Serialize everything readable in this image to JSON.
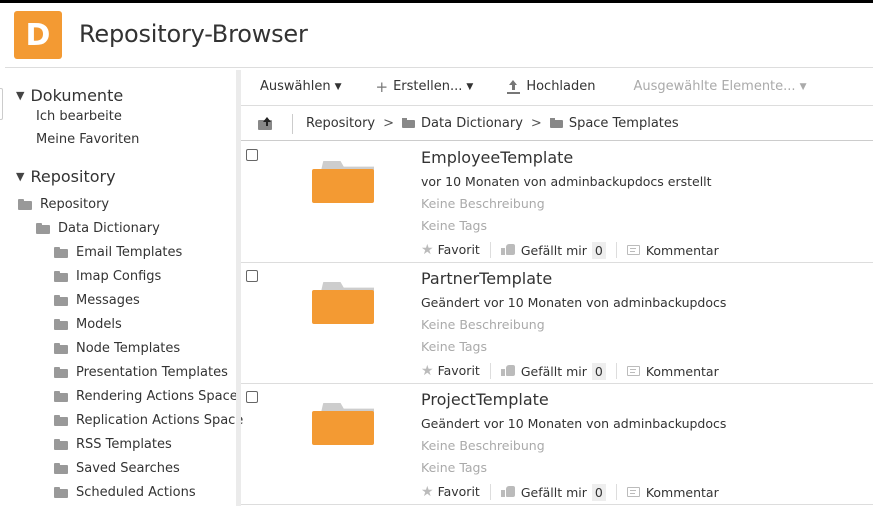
{
  "app": {
    "logo_letter": "D",
    "title": "Repository-Browser",
    "accent_color": "#f39a33"
  },
  "sidebar": {
    "documents": {
      "header": "Dokumente",
      "links": [
        "Ich bearbeite",
        "Meine Favoriten"
      ]
    },
    "repository": {
      "header": "Repository",
      "root": "Repository",
      "level1": "Data Dictionary",
      "children": [
        "Email Templates",
        "Imap Configs",
        "Messages",
        "Models",
        "Node Templates",
        "Presentation Templates",
        "Rendering Actions Space",
        "Replication Actions Space",
        "RSS Templates",
        "Saved Searches",
        "Scheduled Actions"
      ]
    }
  },
  "toolbar": {
    "select_label": "Auswählen",
    "create_label": "Erstellen...",
    "upload_label": "Hochladen",
    "selected_items_label": "Ausgewählte Elemente..."
  },
  "breadcrumb": {
    "items": [
      "Repository",
      "Data Dictionary",
      "Space Templates"
    ],
    "separator": ">"
  },
  "items": [
    {
      "name": "EmployeeTemplate",
      "meta": "vor 10 Monaten von adminbackupdocs erstellt",
      "description": "Keine Beschreibung",
      "tags": "Keine Tags",
      "favorite_label": "Favorit",
      "like_label": "Gefällt mir",
      "like_count": "0",
      "comment_label": "Kommentar"
    },
    {
      "name": "PartnerTemplate",
      "meta": "Geändert vor 10 Monaten von adminbackupdocs",
      "description": "Keine Beschreibung",
      "tags": "Keine Tags",
      "favorite_label": "Favorit",
      "like_label": "Gefällt mir",
      "like_count": "0",
      "comment_label": "Kommentar"
    },
    {
      "name": "ProjectTemplate",
      "meta": "Geändert vor 10 Monaten von adminbackupdocs",
      "description": "Keine Beschreibung",
      "tags": "Keine Tags",
      "favorite_label": "Favorit",
      "like_label": "Gefällt mir",
      "like_count": "0",
      "comment_label": "Kommentar"
    }
  ]
}
